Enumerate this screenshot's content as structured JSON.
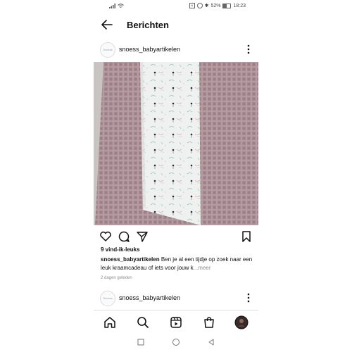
{
  "status_bar": {
    "signal": "signal",
    "wifi": "wifi",
    "notif_icons": "NFC alarm bluetooth",
    "battery": "52%",
    "time": "18:23"
  },
  "header": {
    "title": "Berichten"
  },
  "post": {
    "username": "snoess_babyartikelen",
    "avatar_text": "Snoess",
    "likes": "9 vind-ik-leuks",
    "caption_user": "snoess_babyartikelen",
    "caption_text": " Ben je al een tijdje op zoek naar een leuk kraamcadeau of iets voor jouw k",
    "caption_more": "...meer",
    "date": "2 dagen geleden"
  },
  "post2": {
    "username": "snoess_babyartikelen",
    "avatar_text": "Snoess"
  },
  "colors": {
    "waffle": "#b79fa4",
    "fabric": "#eef1ef",
    "accent": "#1a1a1a"
  }
}
